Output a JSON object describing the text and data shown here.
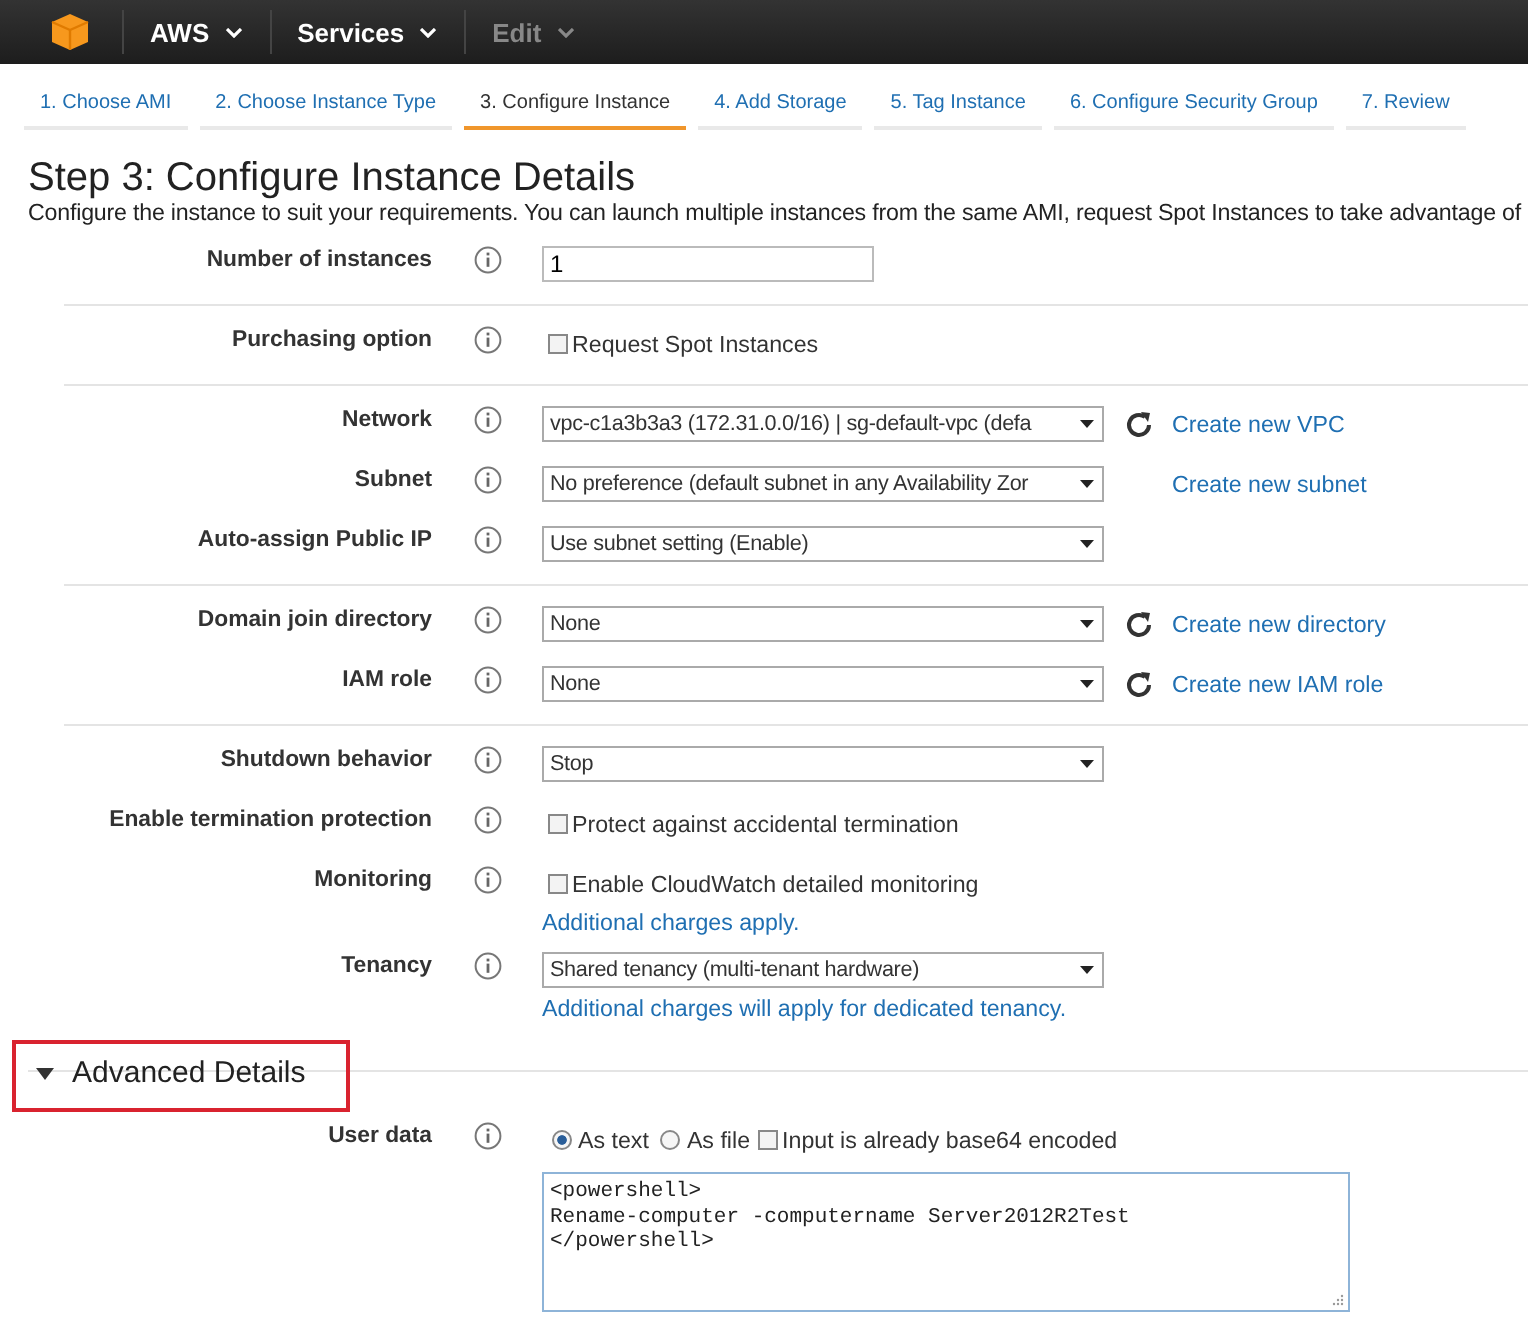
{
  "topbar": {
    "menus": [
      {
        "label": "AWS",
        "disabled": false
      },
      {
        "label": "Services",
        "disabled": false
      },
      {
        "label": "Edit",
        "disabled": true
      }
    ]
  },
  "steps": [
    {
      "label": "1. Choose AMI",
      "selected": false
    },
    {
      "label": "2. Choose Instance Type",
      "selected": false
    },
    {
      "label": "3. Configure Instance",
      "selected": true
    },
    {
      "label": "4. Add Storage",
      "selected": false
    },
    {
      "label": "5. Tag Instance",
      "selected": false
    },
    {
      "label": "6. Configure Security Group",
      "selected": false
    },
    {
      "label": "7. Review",
      "selected": false
    }
  ],
  "title": "Step 3: Configure Instance Details",
  "description": "Configure the instance to suit your requirements. You can launch multiple instances from the same AMI, request Spot Instances to take advantage of",
  "groups": [
    {
      "rows": [
        {
          "label": "Number of instances",
          "kind": "input",
          "value": "1"
        }
      ]
    },
    {
      "rows": [
        {
          "label": "Purchasing option",
          "kind": "checkbox",
          "text": "Request Spot Instances",
          "checked": false
        }
      ]
    },
    {
      "rows": [
        {
          "label": "Network",
          "kind": "select",
          "value": "vpc-c1a3b3a3 (172.31.0.0/16) | sg-default-vpc (defa",
          "action": {
            "label": "Create new VPC",
            "refresh": true
          }
        },
        {
          "label": "Subnet",
          "kind": "select",
          "value": "No preference (default subnet in any Availability Zor",
          "action": {
            "label": "Create new subnet",
            "refresh": false
          }
        },
        {
          "label": "Auto-assign Public IP",
          "kind": "select",
          "value": "Use subnet setting (Enable)"
        }
      ]
    },
    {
      "rows": [
        {
          "label": "Domain join directory",
          "kind": "select",
          "value": "None",
          "action": {
            "label": "Create new directory",
            "refresh": true
          }
        },
        {
          "label": "IAM role",
          "kind": "select",
          "value": "None",
          "action": {
            "label": "Create new IAM role",
            "refresh": true
          }
        }
      ]
    },
    {
      "rows": [
        {
          "label": "Shutdown behavior",
          "kind": "select",
          "value": "Stop"
        },
        {
          "label": "Enable termination protection",
          "kind": "checkbox",
          "text": "Protect against accidental termination",
          "checked": false
        },
        {
          "label": "Monitoring",
          "kind": "checkbox",
          "text": "Enable CloudWatch detailed monitoring",
          "checked": false,
          "note": "Additional charges apply."
        },
        {
          "label": "Tenancy",
          "kind": "select",
          "value": "Shared tenancy (multi-tenant hardware)",
          "note": "Additional charges will apply for dedicated tenancy."
        }
      ]
    }
  ],
  "advanced": {
    "title": "Advanced Details",
    "expanded": true,
    "highlighted": true,
    "user_data": {
      "label": "User data",
      "options": [
        {
          "label": "As text",
          "selected": true
        },
        {
          "label": "As file",
          "selected": false
        }
      ],
      "base64": {
        "label": "Input is already base64 encoded",
        "checked": false
      },
      "value": "<powershell>\nRename-computer -computername Server2012R2Test\n</powershell>"
    }
  }
}
